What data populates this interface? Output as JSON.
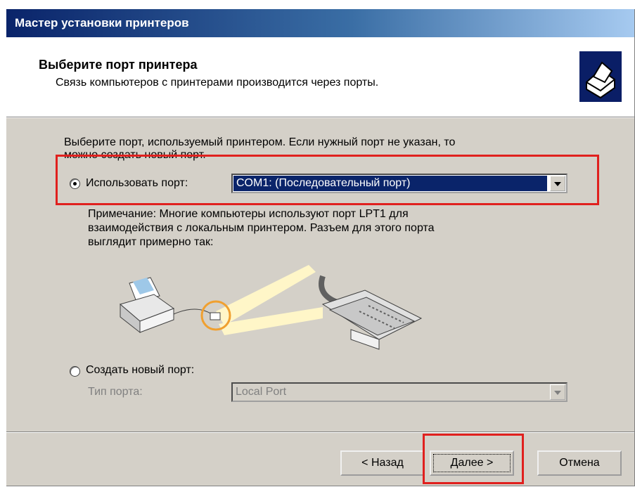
{
  "window": {
    "title": "Мастер установки принтеров"
  },
  "header": {
    "title": "Выберите порт принтера",
    "subtitle": "Связь компьютеров с принтерами производится через порты."
  },
  "body": {
    "instruction_line1": "Выберите порт, используемый принтером. Если нужный порт не указан, то",
    "instruction_line2": "можно создать новый порт.",
    "use_port": {
      "label": "Использовать порт:",
      "selected_value": "COM1: (Последовательный порт)"
    },
    "note": {
      "line1": "Примечание: Многие компьютеры используют порт LPT1 для",
      "line2": "взаимодействия с локальным принтером. Разъем для этого порта",
      "line3": "выглядит примерно так:"
    },
    "create_port": {
      "label": "Создать новый порт:",
      "type_label": "Тип порта:",
      "type_value": "Local Port"
    }
  },
  "buttons": {
    "back": "< Назад",
    "next": "Далее >",
    "cancel": "Отмена"
  },
  "colors": {
    "title_bar": "#0a246a",
    "highlight": "#e0201e",
    "selection": "#0a246a"
  }
}
